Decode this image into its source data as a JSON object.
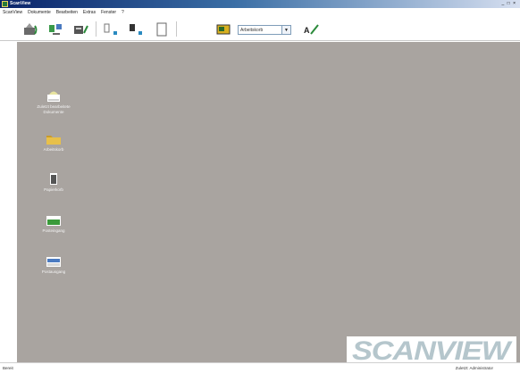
{
  "window": {
    "title": "ScanView",
    "controls": "_ □ ×"
  },
  "menu": {
    "items": [
      "ScanView",
      "Dokumente",
      "Bearbeiten",
      "Extras",
      "Fenster",
      "?"
    ]
  },
  "toolbar": {
    "buttons": [
      {
        "name": "scan-button",
        "icon": "scanner-icon"
      },
      {
        "name": "import-button",
        "icon": "import-icon"
      },
      {
        "name": "batch-button",
        "icon": "batch-icon"
      },
      {
        "name": "add-page-button",
        "icon": "add-page-icon"
      },
      {
        "name": "insert-page-button",
        "icon": "insert-page-icon"
      },
      {
        "name": "blank-page-button",
        "icon": "page-icon"
      },
      {
        "name": "image-button",
        "icon": "image-icon"
      },
      {
        "name": "signature-button",
        "icon": "signature-icon"
      }
    ],
    "dropdown_value": "Arbeitskorb"
  },
  "desktop": {
    "icons": [
      {
        "name": "desktop-icon-documents",
        "icon": "scanner-icon",
        "label": "Zuletzt bearbeitete Dokumente"
      },
      {
        "name": "desktop-icon-folder",
        "icon": "folder-icon",
        "label": "Arbeitskorb"
      },
      {
        "name": "desktop-icon-trash",
        "icon": "trash-icon",
        "label": "Papierkorb"
      },
      {
        "name": "desktop-icon-inbox",
        "icon": "inbox-icon",
        "label": "Posteingang"
      },
      {
        "name": "desktop-icon-outbox",
        "icon": "outbox-icon",
        "label": "Postausgang"
      }
    ]
  },
  "branding": {
    "logo_text": "SCANVIEW",
    "logo_color": "#b5c6cc"
  },
  "status": {
    "left": "Bereit",
    "right": "Zuletzt: Administrator"
  },
  "colors": {
    "workspace": "#a9a4a0",
    "titlebar": "#0a246a",
    "folder": "#e8c04a",
    "inbox": "#3a9a3a"
  }
}
